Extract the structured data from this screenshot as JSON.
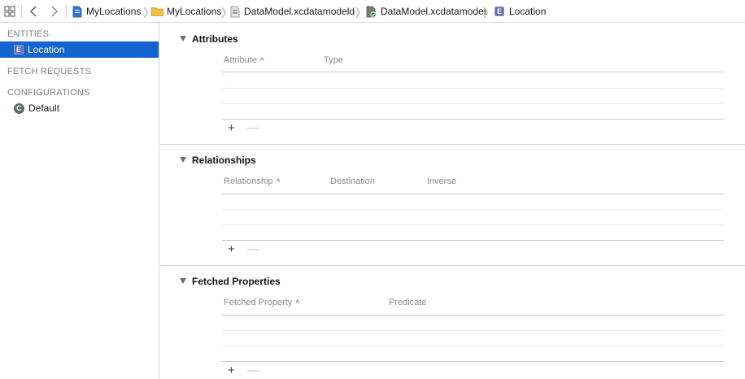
{
  "jumpbar": {
    "path": [
      {
        "label": "MyLocations",
        "icon": "project-file-icon"
      },
      {
        "label": "MyLocations",
        "icon": "folder-icon"
      },
      {
        "label": "DataModel.xcdatamodeld",
        "icon": "data-model-bundle-icon"
      },
      {
        "label": "DataModel.xcdatamodel",
        "icon": "data-model-version-icon"
      },
      {
        "label": "Location",
        "icon": "entity-icon"
      }
    ]
  },
  "sidebar": {
    "entities_header": "ENTITIES",
    "entities": [
      {
        "label": "Location",
        "badge": "E",
        "selected": true
      }
    ],
    "fetch_requests_header": "FETCH REQUESTS",
    "configurations_header": "CONFIGURATIONS",
    "configurations": [
      {
        "label": "Default",
        "badge": "C"
      }
    ]
  },
  "main": {
    "attributes": {
      "title": "Attributes",
      "columns": [
        "Attribute",
        "Type"
      ],
      "add_label": "+",
      "remove_label": "—"
    },
    "relationships": {
      "title": "Relationships",
      "columns": [
        "Relationship",
        "Destination",
        "Inverse"
      ],
      "add_label": "+",
      "remove_label": "—"
    },
    "fetched_properties": {
      "title": "Fetched Properties",
      "columns": [
        "Fetched Property",
        "Predicate"
      ],
      "add_label": "+",
      "remove_label": "—"
    }
  },
  "colors": {
    "selection": "#1464d0",
    "entity_badge": "#5f6db3",
    "configuration_badge": "#5c6a6a",
    "folder": "#f0c040"
  }
}
